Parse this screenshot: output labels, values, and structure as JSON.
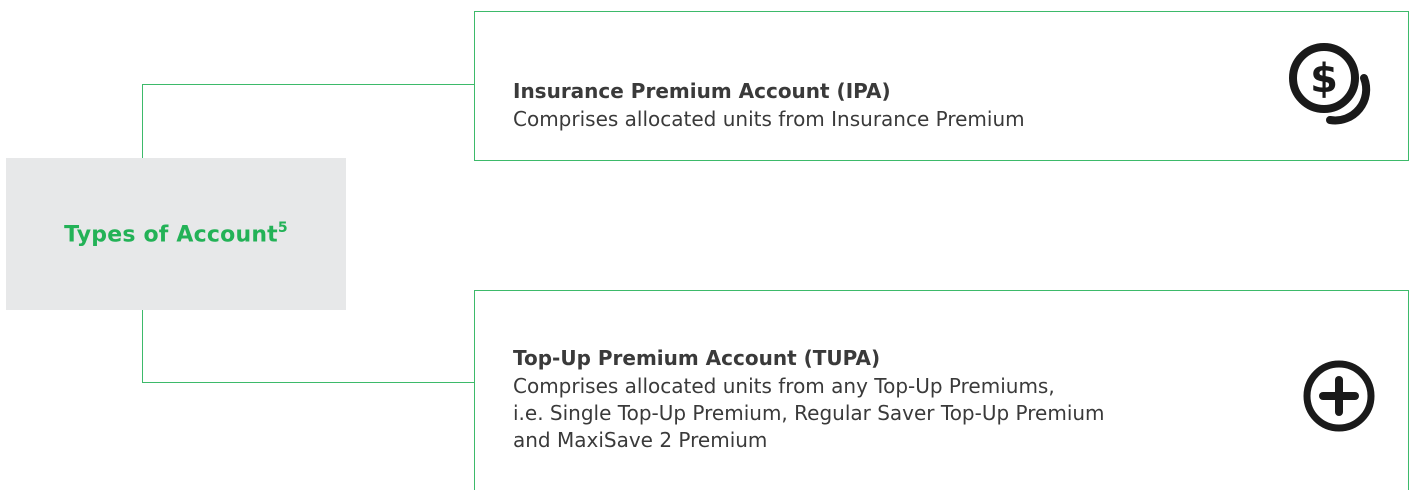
{
  "center": {
    "title": "Types of Account",
    "footnote": "5"
  },
  "accounts": [
    {
      "title": "Insurance Premium Account (IPA)",
      "description": "Comprises allocated units from Insurance Premium",
      "icon": "dollar-coins-icon"
    },
    {
      "title": "Top-Up Premium Account (TUPA)",
      "description": "Comprises allocated units from any Top-Up Premiums,\ni.e. Single Top-Up Premium, Regular Saver Top-Up Premium\nand MaxiSave 2 Premium",
      "icon": "plus-circle-icon"
    }
  ],
  "colors": {
    "accent": "#23b257",
    "connector": "#3dba6a",
    "center_background": "#e7e8e9",
    "text": "#3a3a3a"
  }
}
